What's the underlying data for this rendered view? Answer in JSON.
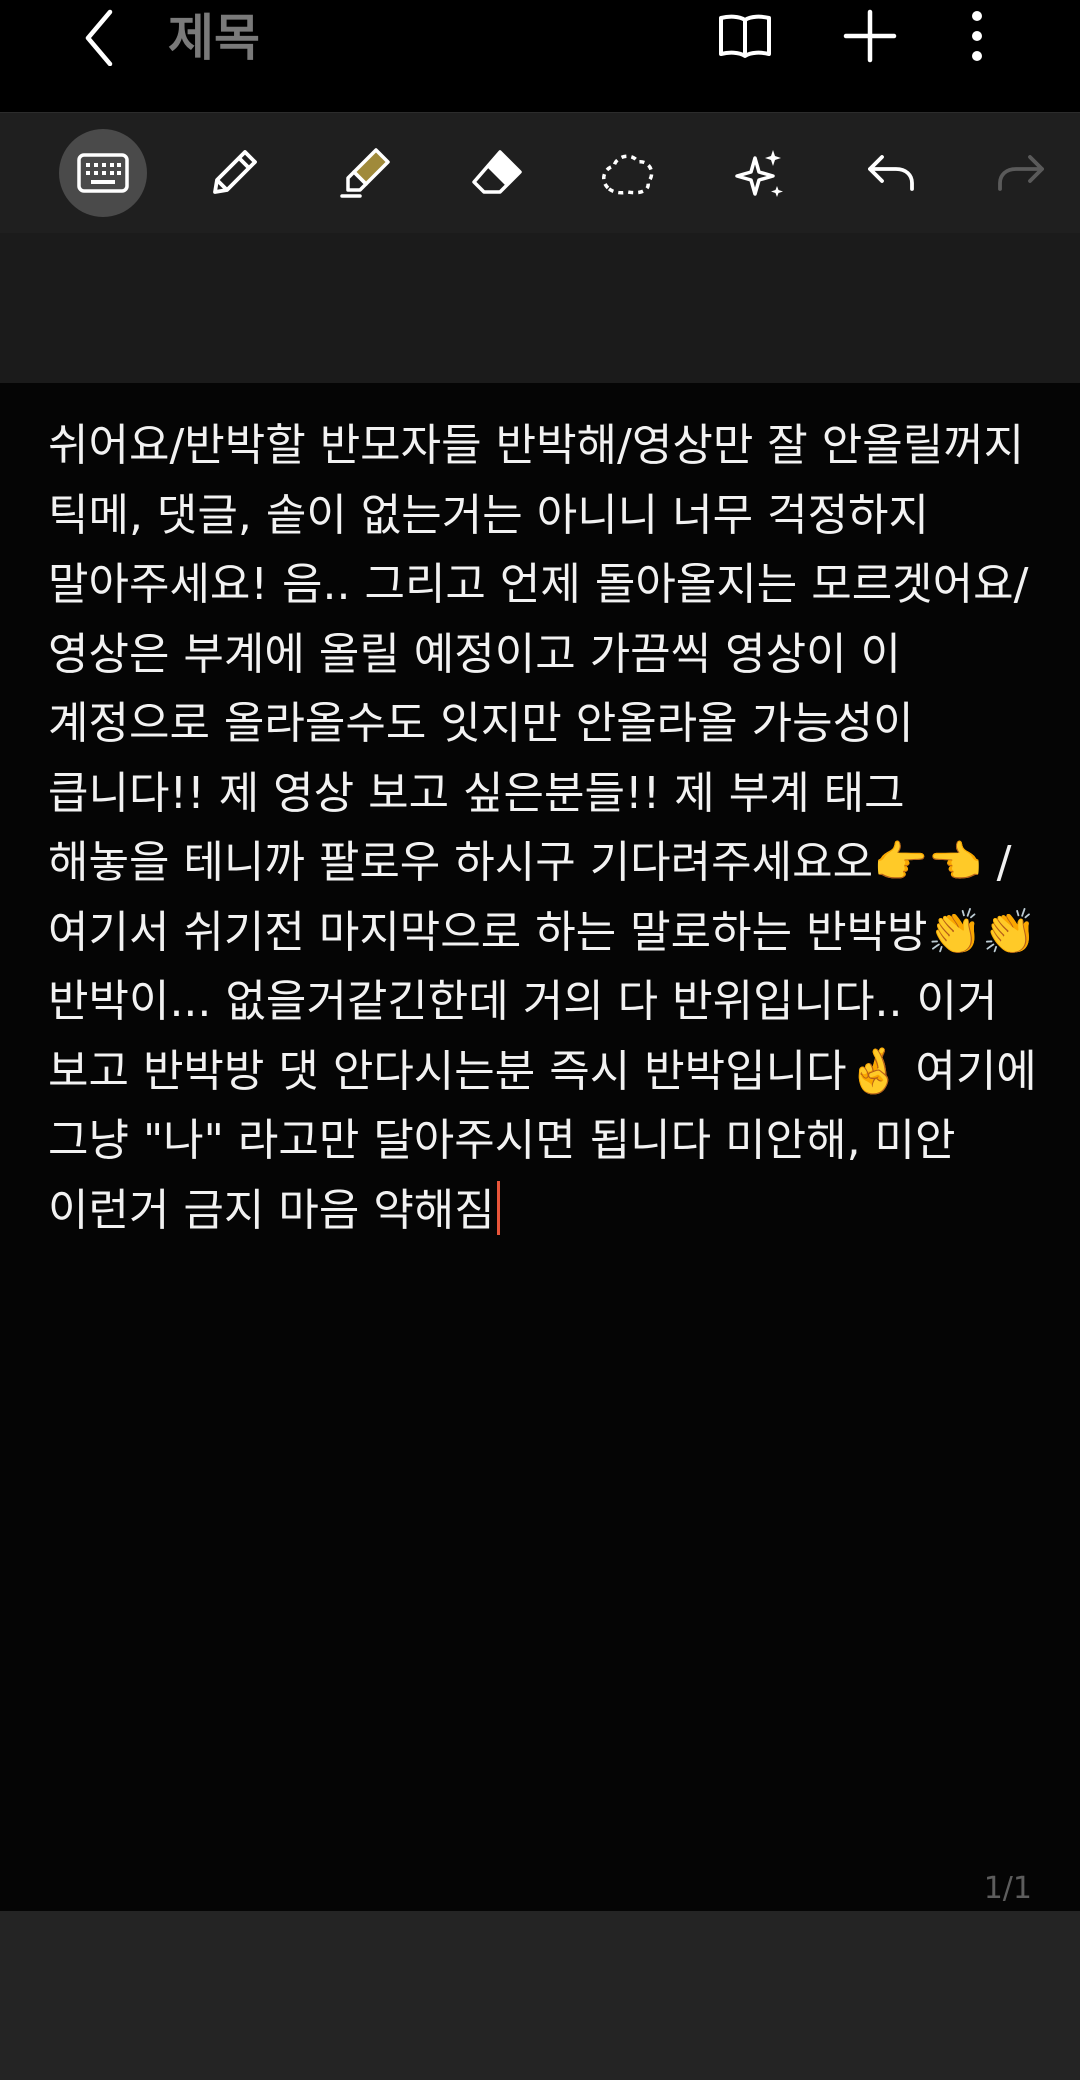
{
  "header": {
    "title": "제목",
    "back_icon": "chevron-left-icon",
    "actions": [
      {
        "name": "book-view-icon"
      },
      {
        "name": "plus-icon"
      },
      {
        "name": "more-vertical-icon"
      }
    ]
  },
  "toolbar": {
    "tools": [
      {
        "name": "keyboard-icon",
        "active": true
      },
      {
        "name": "pen-icon",
        "active": false
      },
      {
        "name": "highlighter-icon",
        "active": false
      },
      {
        "name": "eraser-icon",
        "active": false
      },
      {
        "name": "lasso-select-icon",
        "active": false
      },
      {
        "name": "ai-sparkle-icon",
        "active": false
      },
      {
        "name": "undo-icon",
        "active": false
      },
      {
        "name": "redo-icon",
        "active": false,
        "disabled": true
      }
    ],
    "highlighter_color": "#a08a3a"
  },
  "note": {
    "body": "쉬어요/반박할 반모자들 반박해/영상만 잘 안올릴꺼지 틱메, 댓글, 솥이 없는거는 아니니 너무 걱정하지 말아주세요! 음.. 그리고 언제 돌아올지는 모르겟어요/영상은 부계에 올릴 예정이고 가끔씩 영상이 이 계정으로 올라올수도 잇지만 안올라올 가능성이 큽니다!! 제 영상 보고 싶은분들!! 제 부계 태그 해놓을 테니까 팔로우 하시구 기다려주세요오👉👈 /여기서 쉬기전 마지막으로 하는 말로하는 반박방👏👏 반박이... 없을거같긴한데 거의 다 반위입니다.. 이거 보고 반박방 댓 안다시는분 즉시 반박입니다🤞 여기에 그냥 \"나\" 라고만 달아주시면 됩니다 미안해, 미안 이런거 금지 마음 약해짐"
  },
  "page_indicator": "1/1",
  "colors": {
    "background": "#000000",
    "toolbar": "#1f1f1f",
    "cursor": "#e8553a"
  }
}
